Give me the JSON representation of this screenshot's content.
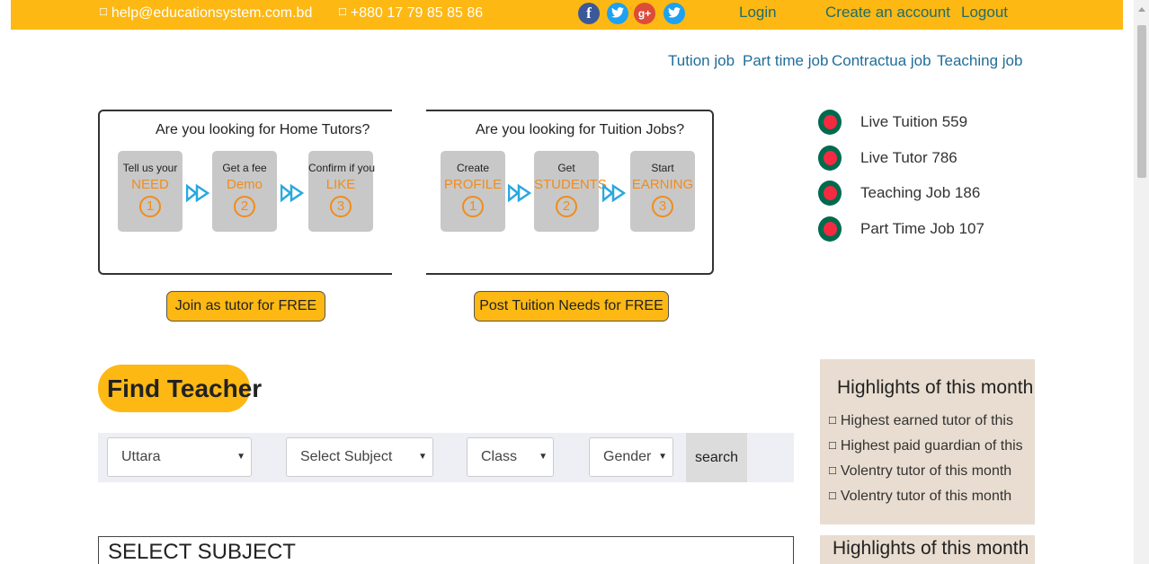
{
  "topbar": {
    "email": "help@educationsystem.com.bd",
    "phone": "+880 17 79 85 85 86",
    "social": [
      {
        "name": "facebook",
        "glyph": "f",
        "color": "#3b5998"
      },
      {
        "name": "twitter",
        "glyph": "",
        "color": "#1da1f2"
      },
      {
        "name": "google-plus",
        "glyph": "g+",
        "color": "#dd4b39"
      },
      {
        "name": "twitter",
        "glyph": "",
        "color": "#1da1f2"
      }
    ],
    "login": "Login",
    "create_account": "Create an account",
    "logout": "Logout"
  },
  "nav": [
    "Tution job",
    "Part time job",
    "Contractua job",
    "Teaching job"
  ],
  "process": {
    "left_title": "Are you looking for Home Tutors?",
    "right_title": "Are you looking for Tuition Jobs?",
    "left_steps": [
      {
        "top": "Tell us your",
        "word": "NEED",
        "num": "1"
      },
      {
        "top": "Get a fee",
        "word": "Demo",
        "num": "2"
      },
      {
        "top": "Confirm if you",
        "word": "LIKE",
        "num": "3"
      }
    ],
    "right_steps": [
      {
        "top": "Create",
        "word": "PROFILE",
        "num": "1"
      },
      {
        "top": "Get",
        "word": "STUDENTS",
        "num": "2"
      },
      {
        "top": "Start",
        "word": "EARNING",
        "num": "3"
      }
    ]
  },
  "buttons": {
    "join_tutor": "Join as tutor for FREE",
    "post_tuition": "Post Tuition Needs for FREE"
  },
  "live_stats": [
    "Live Tuition 559",
    "Live Tutor 786",
    "Teaching Job 186",
    "Part Time Job 107"
  ],
  "find": {
    "title": "Find Teacher",
    "location": "Uttara",
    "subject": "Select Subject",
    "class": "Class",
    "gender": "Gender",
    "search": "search"
  },
  "select_subject_heading": "SELECT SUBJECT",
  "highlights": {
    "title": "Highlights of this month",
    "items": [
      "Highest earned tutor of this",
      "Highest paid guardian of this",
      "Volentry tutor of this month",
      "Volentry tutor of this month"
    ],
    "title2": "Highlights of this month"
  },
  "colors": {
    "accent": "#fdb813",
    "link": "#1f6d9a",
    "step_word": "#f08c1c",
    "highlight_bg": "#e8ddd0"
  }
}
